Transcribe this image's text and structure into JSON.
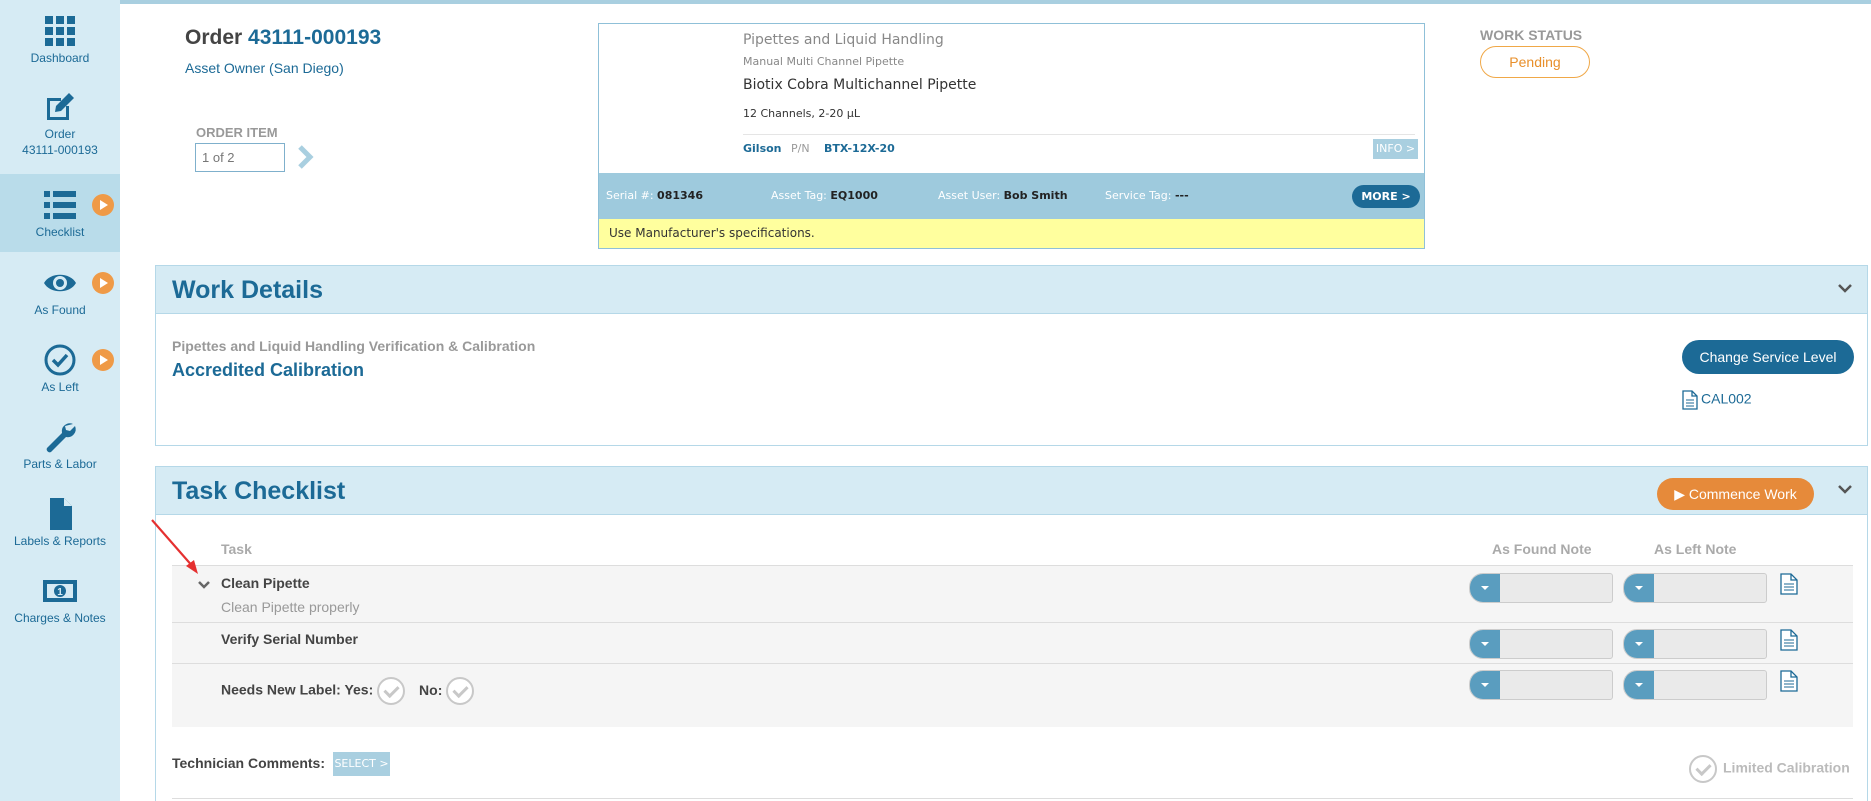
{
  "sidebar": {
    "items": [
      {
        "label": "Dashboard",
        "icon": "grid-icon"
      },
      {
        "label": "Order",
        "sublabel": "43111-000193",
        "icon": "edit-icon"
      },
      {
        "label": "Checklist",
        "icon": "list-icon"
      },
      {
        "label": "As Found",
        "icon": "eye-icon"
      },
      {
        "label": "As Left",
        "icon": "check-circle-icon"
      },
      {
        "label": "Parts & Labor",
        "icon": "wrench-icon"
      },
      {
        "label": "Labels & Reports",
        "icon": "document-icon"
      },
      {
        "label": "Charges & Notes",
        "icon": "money-icon"
      }
    ]
  },
  "header": {
    "order_prefix": "Order",
    "order_number": "43111-000193",
    "asset_owner": "Asset Owner (San Diego)",
    "order_item_label": "ORDER ITEM",
    "order_item_value": "1 of 2"
  },
  "asset": {
    "category": "Pipettes and Liquid Handling",
    "subcategory": "Manual Multi Channel Pipette",
    "name": "Biotix Cobra Multichannel Pipette",
    "spec": "12 Channels, 2-20 µL",
    "manufacturer": "Gilson",
    "pn_label": "P/N",
    "pn": "BTX-12X-20",
    "info_label": "INFO >",
    "serial_label": "Serial #:",
    "serial": "081346",
    "asset_tag_label": "Asset Tag:",
    "asset_tag": "EQ1000",
    "asset_user_label": "Asset User:",
    "asset_user": "Bob Smith",
    "service_tag_label": "Service Tag:",
    "service_tag": "---",
    "more_label": "MORE >",
    "note": "Use Manufacturer's specifications."
  },
  "work_status": {
    "label": "WORK STATUS",
    "value": "Pending"
  },
  "work_details": {
    "title": "Work Details",
    "service_type": "Pipettes and Liquid Handling Verification & Calibration",
    "service_level": "Accredited Calibration",
    "change_button": "Change Service Level",
    "procedure_link": "CAL002"
  },
  "task_checklist": {
    "title": "Task Checklist",
    "commence_button": "▶ Commence Work",
    "col_task": "Task",
    "col_as_found": "As Found Note",
    "col_as_left": "As Left Note",
    "tasks": [
      {
        "title": "Clean Pipette",
        "description": "Clean Pipette properly"
      },
      {
        "title": "Verify Serial Number"
      }
    ],
    "label_question": "Needs New Label: Yes:",
    "label_no": "No:",
    "technician_comments_label": "Technician Comments:",
    "select_button": "SELECT >",
    "limited_calibration": "Limited Calibration"
  },
  "colors": {
    "primary": "#1c6a96",
    "sidebar_bg": "#d6ebf4",
    "accent_orange": "#e68a3a",
    "note_yellow": "#ffff9e"
  }
}
